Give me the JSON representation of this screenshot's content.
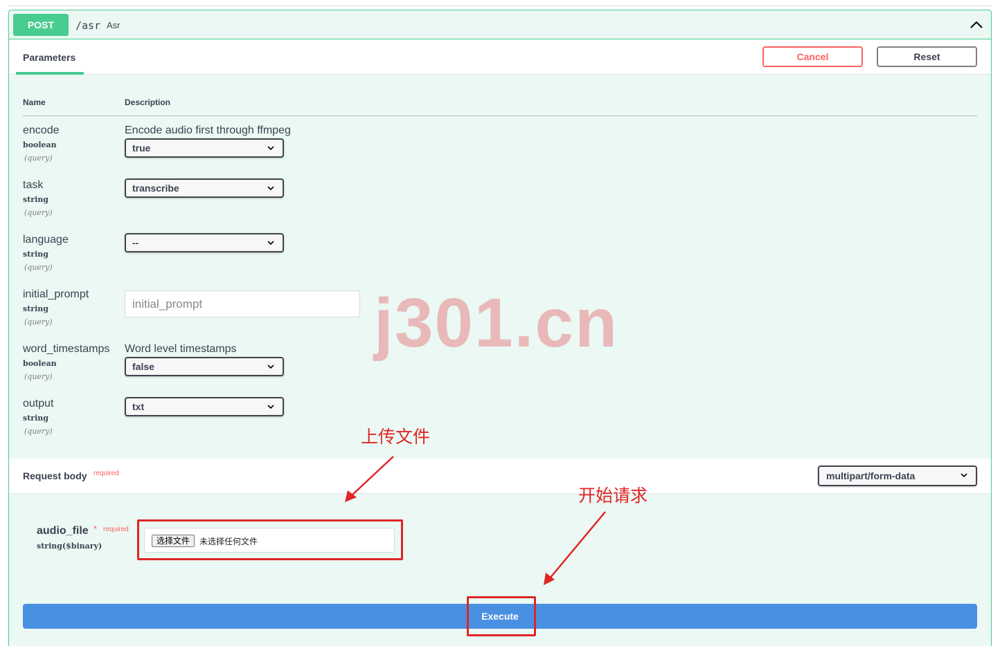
{
  "operation": {
    "method": "POST",
    "path": "/asr",
    "summary": "Asr"
  },
  "tabs": {
    "parameters_label": "Parameters",
    "cancel_label": "Cancel",
    "reset_label": "Reset"
  },
  "table": {
    "name_header": "Name",
    "description_header": "Description"
  },
  "params": [
    {
      "name": "encode",
      "type": "boolean",
      "in": "(query)",
      "description": "Encode audio first through ffmpeg",
      "control": "select",
      "value": "true"
    },
    {
      "name": "task",
      "type": "string",
      "in": "(query)",
      "description": "",
      "control": "select",
      "value": "transcribe"
    },
    {
      "name": "language",
      "type": "string",
      "in": "(query)",
      "description": "",
      "control": "select",
      "value": "--"
    },
    {
      "name": "initial_prompt",
      "type": "string",
      "in": "(query)",
      "description": "",
      "control": "text",
      "placeholder": "initial_prompt"
    },
    {
      "name": "word_timestamps",
      "type": "boolean",
      "in": "(query)",
      "description": "Word level timestamps",
      "control": "select",
      "value": "false"
    },
    {
      "name": "output",
      "type": "string",
      "in": "(query)",
      "description": "",
      "control": "select",
      "value": "txt"
    }
  ],
  "request_body": {
    "title": "Request body",
    "required_label": "required",
    "content_type": "multipart/form-data",
    "field": {
      "name": "audio_file",
      "star": "*",
      "required_label": "required",
      "type": "string($binary)",
      "choose_button": "选择文件",
      "no_file_text": "未选择任何文件"
    }
  },
  "execute_label": "Execute",
  "annotations": {
    "upload": "上传文件",
    "start": "开始请求",
    "watermark": "j301.cn"
  },
  "colors": {
    "post": "#49cc90",
    "execute": "#4990e2",
    "cancel": "#ff6060",
    "annotation": "#e02525"
  }
}
